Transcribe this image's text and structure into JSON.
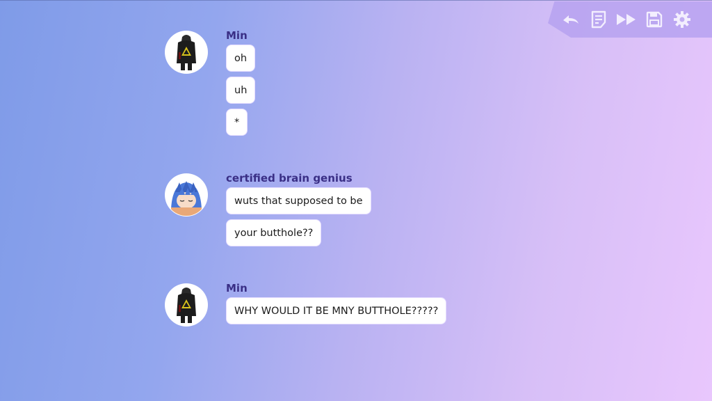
{
  "toolbar": {
    "buttons": [
      {
        "name": "back-button",
        "icon": "curved-arrow-left-icon"
      },
      {
        "name": "history-button",
        "icon": "document-lines-icon"
      },
      {
        "name": "skip-button",
        "icon": "fast-forward-icon"
      },
      {
        "name": "save-button",
        "icon": "floppy-disk-icon"
      },
      {
        "name": "settings-button",
        "icon": "gear-icon"
      }
    ],
    "icon_color": "#f3eefe"
  },
  "colors": {
    "sender_name": "#3a2f86",
    "bubble_bg": "#ffffff",
    "gradient_start": "#7f9be8",
    "gradient_end": "#e9c7fd"
  },
  "messages": [
    {
      "sender": "Min",
      "avatar": "black-robed-figure-avatar",
      "lines": [
        "oh",
        "uh",
        "*"
      ]
    },
    {
      "sender": "certified brain genius",
      "avatar": "blue-haired-anime-girl-avatar",
      "lines": [
        "wuts that supposed to be",
        "your butthole??"
      ]
    },
    {
      "sender": "Min",
      "avatar": "black-robed-figure-avatar",
      "lines": [
        "WHY WOULD IT BE MNY BUTTHOLE?????"
      ]
    }
  ]
}
